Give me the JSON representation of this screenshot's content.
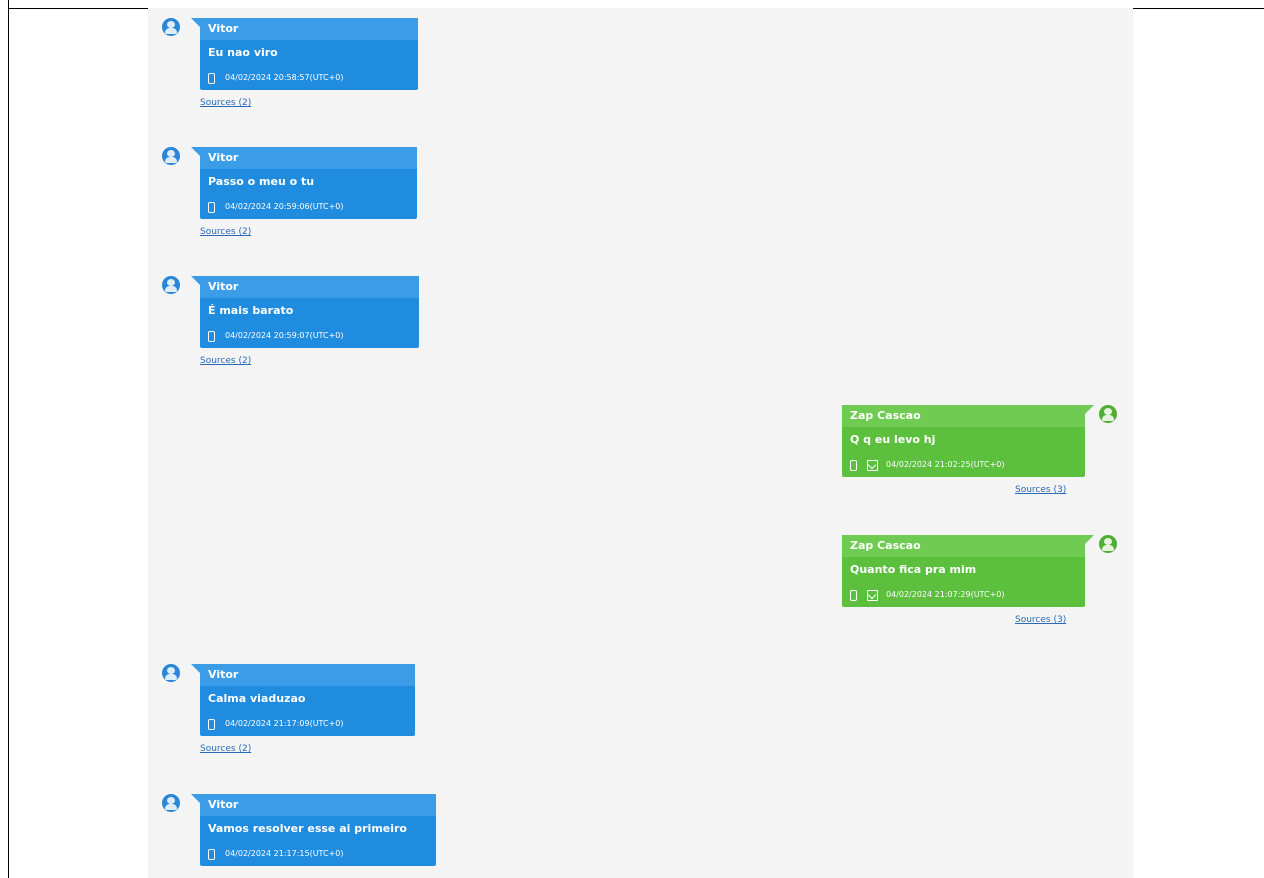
{
  "messages": [
    {
      "side": "left",
      "sender": "Vitor",
      "text": "Eu nao viro",
      "timestamp": "04/02/2024 20:58:57(UTC+0)",
      "sources": "Sources (2)",
      "mail": false
    },
    {
      "side": "left",
      "sender": "Vitor",
      "text": "Passo o meu o tu",
      "timestamp": "04/02/2024 20:59:06(UTC+0)",
      "sources": "Sources (2)",
      "mail": false
    },
    {
      "side": "left",
      "sender": "Vitor",
      "text": "É mais barato",
      "timestamp": "04/02/2024 20:59:07(UTC+0)",
      "sources": "Sources (2)",
      "mail": false
    },
    {
      "side": "right",
      "sender": "Zap Cascao",
      "text": "Q q eu levo hj",
      "timestamp": "04/02/2024 21:02:25(UTC+0)",
      "sources": "Sources (3)",
      "mail": true
    },
    {
      "side": "right",
      "sender": "Zap Cascao",
      "text": "Quanto fica pra mim",
      "timestamp": "04/02/2024 21:07:29(UTC+0)",
      "sources": "Sources (3)",
      "mail": true
    },
    {
      "side": "left",
      "sender": "Vitor",
      "text": "Calma viaduzao",
      "timestamp": "04/02/2024 21:17:09(UTC+0)",
      "sources": "Sources (2)",
      "mail": false
    },
    {
      "side": "left",
      "sender": "Vitor",
      "text": "Vamos resolver esse ai primeiro",
      "timestamp": "04/02/2024 21:17:15(UTC+0)",
      "sources": "",
      "mail": false
    }
  ],
  "colors": {
    "left_bubble": "#1f8ce0",
    "right_bubble": "#5cbf3e",
    "chat_background": "#f4f4f4",
    "link": "#2a6ab8"
  },
  "icons": {
    "device": "phone-icon",
    "delivered": "mail-icon",
    "avatar": "user-avatar-icon"
  }
}
